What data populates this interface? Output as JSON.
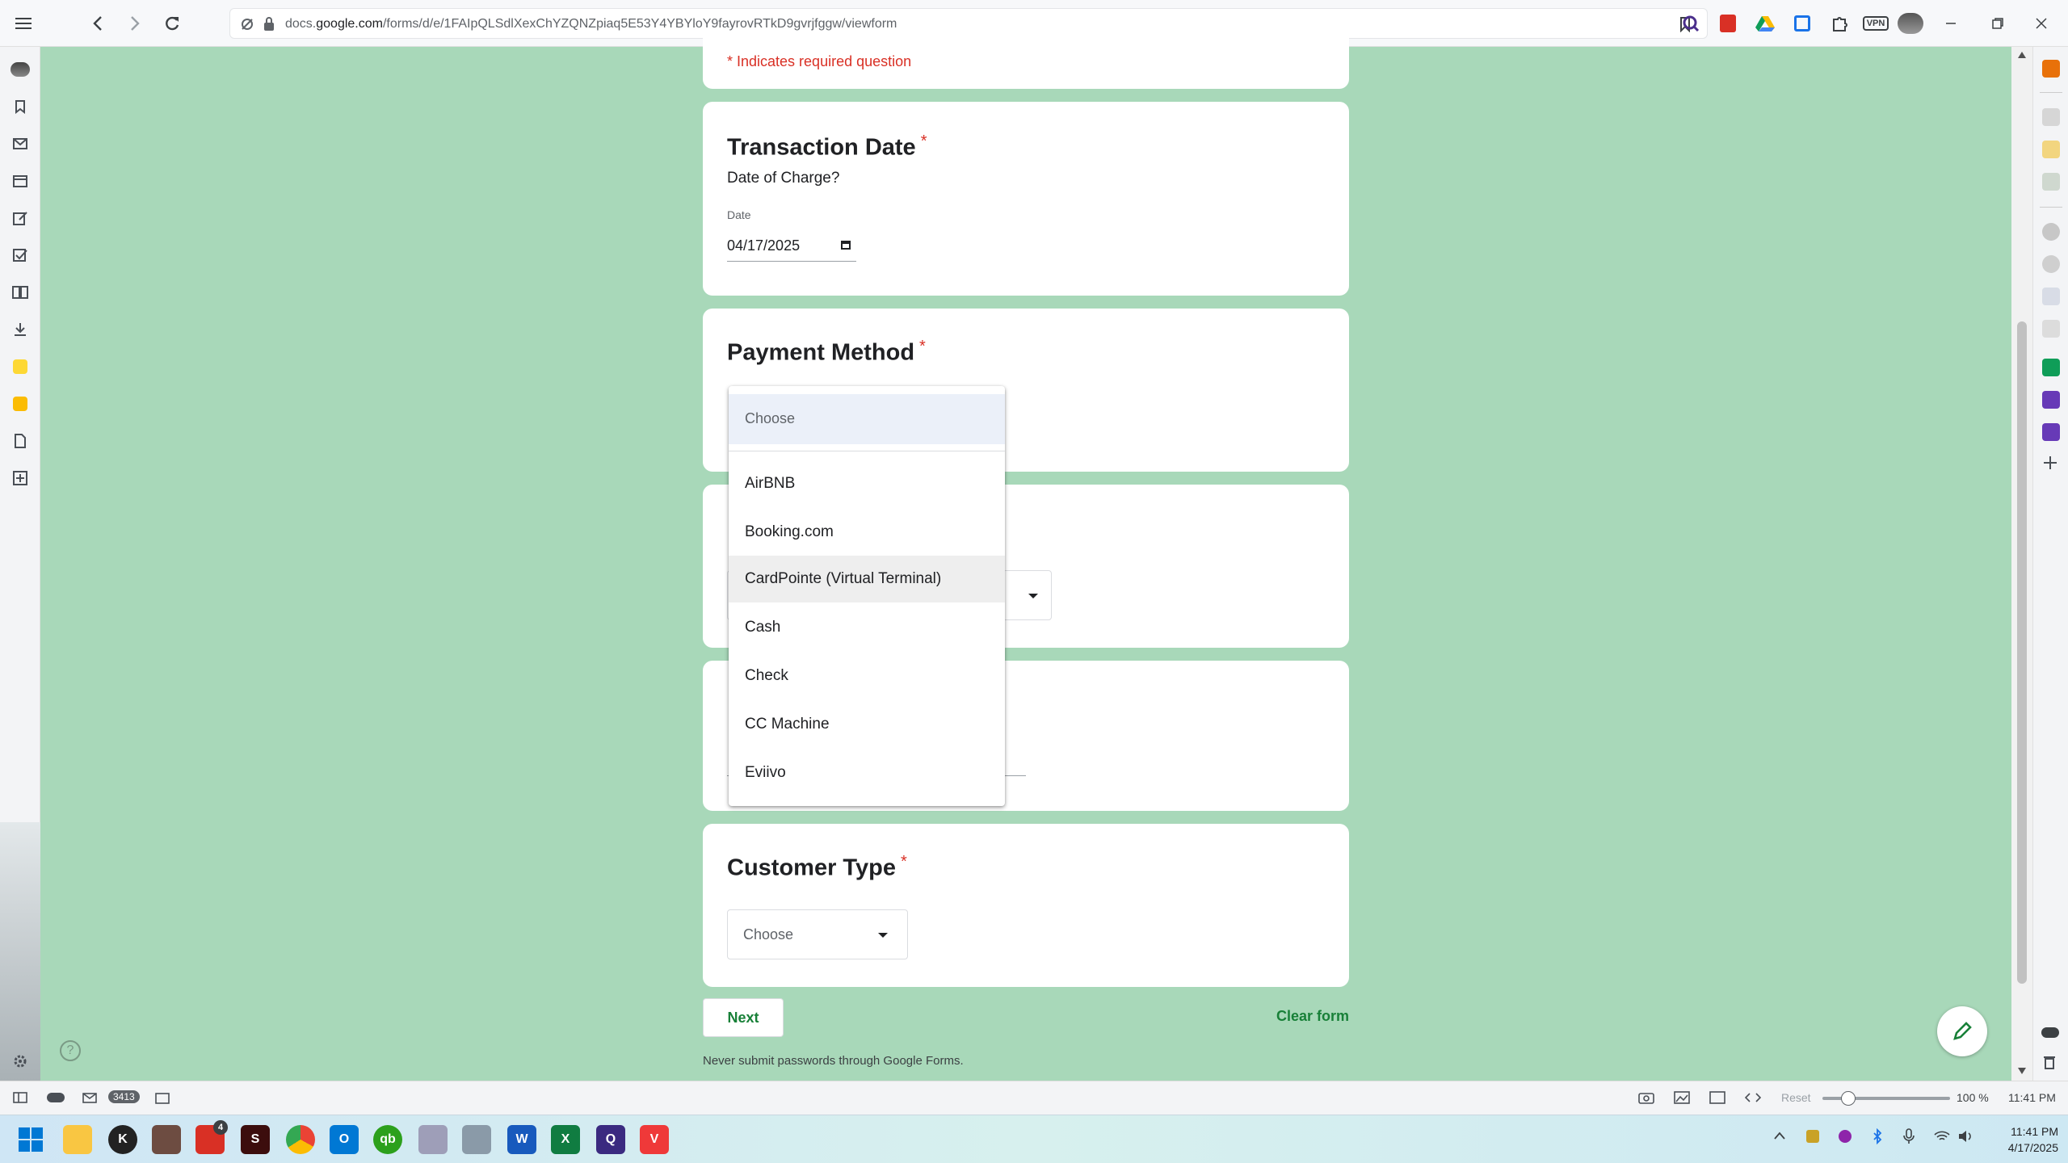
{
  "browser": {
    "url_prefix": "docs.",
    "url_domain": "google.com",
    "url_path": "/forms/d/e/1FAIpQLSdlXexChYZQNZpiaq5E53Y4YBYloY9fayrovRTkD9gvrjfggw/viewform",
    "vpn_label": "VPN"
  },
  "form": {
    "required_note": "* Indicates required question",
    "q1": {
      "title": "Transaction Date",
      "asterisk": "*",
      "description": "Date of Charge?",
      "field_label": "Date",
      "value": "04/17/2025"
    },
    "q2": {
      "title": "Payment Method",
      "asterisk": "*"
    },
    "q5": {
      "title": "Customer Type",
      "asterisk": "*",
      "placeholder": "Choose"
    },
    "next_label": "Next",
    "clear_label": "Clear form",
    "footer_note": "Never submit passwords through Google Forms."
  },
  "dropdown": {
    "placeholder": "Choose",
    "options": [
      "AirBNB",
      "Booking.com",
      "CardPointe (Virtual Terminal)",
      "Cash",
      "Check",
      "CC Machine",
      "Eviivo"
    ],
    "highlighted": "CardPointe (Virtual Terminal)"
  },
  "statusbar": {
    "mail_count": "3413",
    "reset_label": "Reset",
    "zoom": "100 %",
    "time": "11:41 PM",
    "zoom_level": 0.2
  },
  "taskbar": {
    "badge_count": "4",
    "clock_time": "11:41 PM",
    "clock_date": "4/17/2025"
  },
  "colors": {
    "background": "#a8d8b9",
    "accent_green": "#188038",
    "required_red": "#d93025"
  }
}
